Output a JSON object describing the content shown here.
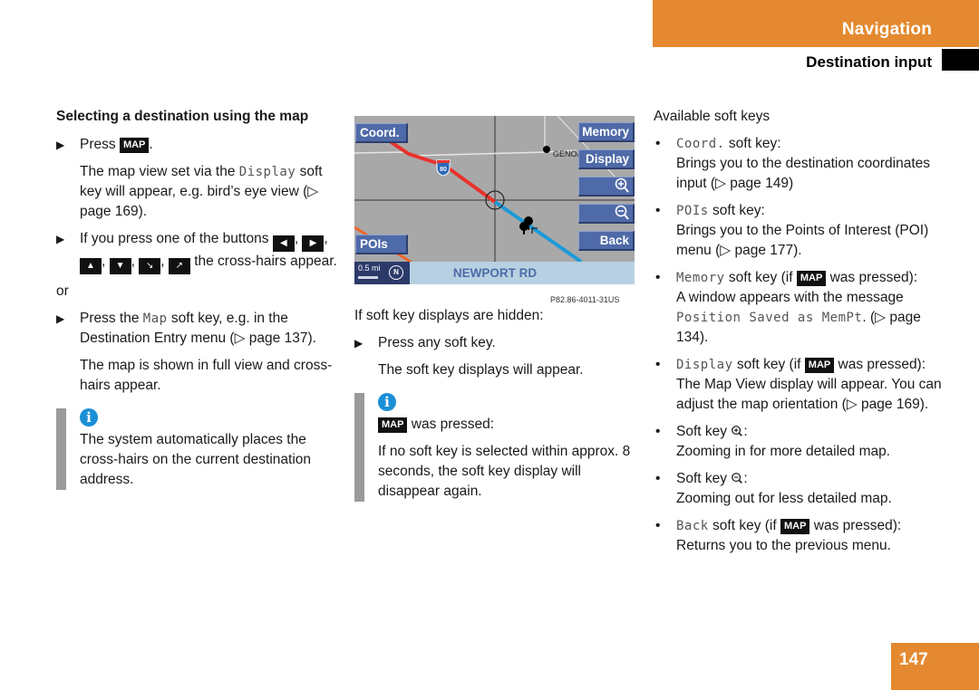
{
  "header": {
    "chapter": "Navigation",
    "section": "Destination input"
  },
  "left_column": {
    "heading": "Selecting a destination using the map",
    "step1_prefix": "Press",
    "step1_key": "MAP",
    "step1_suffix": ".",
    "step1_result_a": "The map view set via the",
    "step1_result_mono": "Display",
    "step1_result_b": "soft key will appear, e.g. bird’s eye view (▷ page 169).",
    "step2_text": "If you press one of the buttons",
    "step2_buttons": [
      "◀",
      "▶",
      "▲",
      "▼",
      "↘",
      "↗"
    ],
    "step2_suffix": "the cross-hairs appear.",
    "or": "or",
    "step3_prefix": "Press the",
    "step3_mono": "Map",
    "step3_suffix": "soft key, e.g. in the Destination Entry menu (▷ page 137).",
    "step3_result": "The map is shown in full view and cross-hairs appear.",
    "info_icon": "info-icon",
    "info_text": "The system automatically places the cross-hairs on the current destination address."
  },
  "map_screen": {
    "softkeys_left": [
      "Coord.",
      "POIs"
    ],
    "softkeys_right": [
      "Memory",
      "Display",
      "zoom-in-icon",
      "zoom-out-icon",
      "Back"
    ],
    "place_label": "GENOA",
    "highway_shield": "80",
    "scale": "0.5 mi",
    "compass": "N",
    "street": "NEWPORT RD",
    "caption": "P82.86-4011-31US",
    "colors": {
      "map_bg": "#a9a8a9",
      "softkey": "#4f6aa8",
      "route_traveled": "#e8322c",
      "route_ahead": "#1c9ad8",
      "status_bar": "#b7d1e2"
    }
  },
  "mid_column": {
    "intro": "If soft key displays are hidden:",
    "step": "Press any soft key.",
    "result": "The soft key displays will appear.",
    "info_key": "MAP",
    "info_line1": "was pressed:",
    "info_text": "If no soft key is selected within approx. 8 seconds, the soft key display will disappear again."
  },
  "right_column": {
    "heading": "Available soft keys",
    "items": [
      {
        "mono": "Coord.",
        "label": "soft key:",
        "desc": "Brings you to the destination coordinates input (▷ page 149)"
      },
      {
        "mono": "POIs",
        "label": "soft key:",
        "desc": "Brings you to the Points of Interest (POI) menu (▷ page 177)."
      },
      {
        "mono": "Memory",
        "label": "soft key (if",
        "key": "MAP",
        "label2": "was pressed):",
        "desc_a": "A window appears with the message",
        "desc_mono": "Position Saved as MemPt",
        "desc_b": ". (▷ page 134)."
      },
      {
        "mono": "Display",
        "label": "soft key (if",
        "key": "MAP",
        "label2": "was pressed):",
        "desc": "The Map View display will appear. You can adjust the map orientation (▷ page 169)."
      },
      {
        "label": "Soft key",
        "icon": "zoom-in-icon",
        "desc": "Zooming in for more detailed map."
      },
      {
        "label": "Soft key",
        "icon": "zoom-out-icon",
        "desc": "Zooming out for less detailed map."
      },
      {
        "mono": "Back",
        "label": "soft key (if",
        "key": "MAP",
        "label2": "was pressed):",
        "desc": "Returns you to the previous menu."
      }
    ]
  },
  "page_number": "147"
}
